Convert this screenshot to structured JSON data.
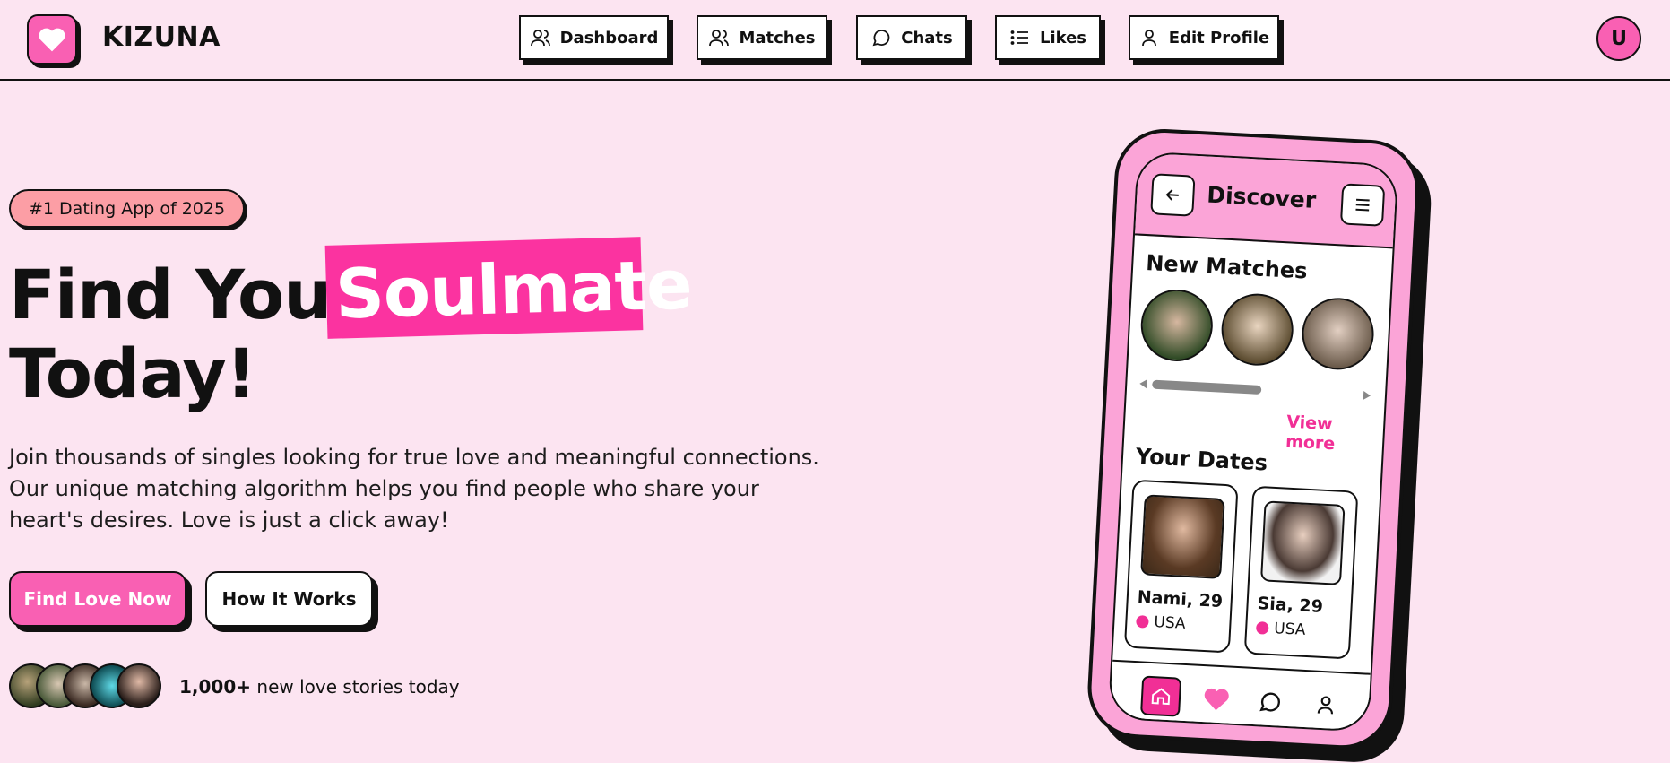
{
  "brand": {
    "name": "KIZUNA",
    "logo_icon": "heart-icon"
  },
  "nav": {
    "items": [
      {
        "label": "Dashboard",
        "icon": "users-icon"
      },
      {
        "label": "Matches",
        "icon": "users-icon"
      },
      {
        "label": "Chats",
        "icon": "chat-bubble-icon"
      },
      {
        "label": "Likes",
        "icon": "list-icon"
      },
      {
        "label": "Edit Profile",
        "icon": "user-icon"
      }
    ],
    "avatar_initial": "U"
  },
  "hero": {
    "badge": "#1 Dating App of 2025",
    "title_part1": "Find Your",
    "title_highlight": "Soulmate",
    "title_part2": "Today!",
    "lead": "Join thousands of singles looking for true love and meaningful connections. Our unique matching algorithm helps you find people who share your heart's desires. Love is just a click away!",
    "cta_primary": "Find Love Now",
    "cta_secondary": "How It Works",
    "stories_count": "1,000+",
    "stories_text": "new love stories today"
  },
  "phone": {
    "header_title": "Discover",
    "new_matches_title": "New Matches",
    "view_more": "View more",
    "your_dates_title": "Your Dates",
    "dates": [
      {
        "name": "Nami, 29",
        "location": "USA"
      },
      {
        "name": "Sia, 29",
        "location": "USA"
      }
    ]
  },
  "colors": {
    "background": "#fce4f1",
    "accent": "#f960b3",
    "highlight": "#fb33a0",
    "badge": "#fc9ea5",
    "phone_frame": "#fba4d7"
  }
}
